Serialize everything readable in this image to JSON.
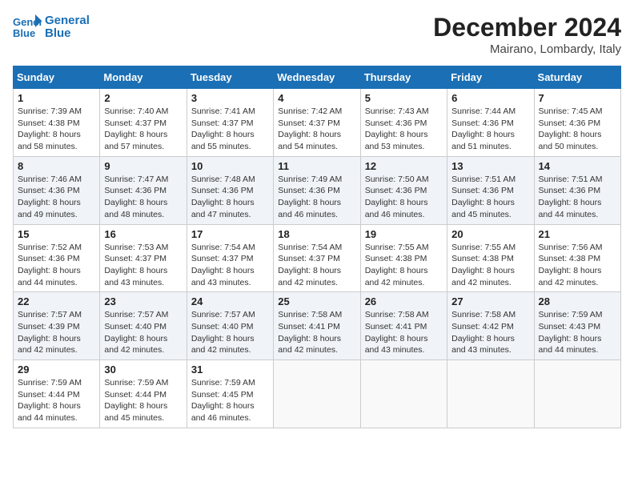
{
  "header": {
    "logo_line1": "General",
    "logo_line2": "Blue",
    "month_title": "December 2024",
    "location": "Mairano, Lombardy, Italy"
  },
  "weekdays": [
    "Sunday",
    "Monday",
    "Tuesday",
    "Wednesday",
    "Thursday",
    "Friday",
    "Saturday"
  ],
  "weeks": [
    [
      {
        "day": "1",
        "info": "Sunrise: 7:39 AM\nSunset: 4:38 PM\nDaylight: 8 hours\nand 58 minutes."
      },
      {
        "day": "2",
        "info": "Sunrise: 7:40 AM\nSunset: 4:37 PM\nDaylight: 8 hours\nand 57 minutes."
      },
      {
        "day": "3",
        "info": "Sunrise: 7:41 AM\nSunset: 4:37 PM\nDaylight: 8 hours\nand 55 minutes."
      },
      {
        "day": "4",
        "info": "Sunrise: 7:42 AM\nSunset: 4:37 PM\nDaylight: 8 hours\nand 54 minutes."
      },
      {
        "day": "5",
        "info": "Sunrise: 7:43 AM\nSunset: 4:36 PM\nDaylight: 8 hours\nand 53 minutes."
      },
      {
        "day": "6",
        "info": "Sunrise: 7:44 AM\nSunset: 4:36 PM\nDaylight: 8 hours\nand 51 minutes."
      },
      {
        "day": "7",
        "info": "Sunrise: 7:45 AM\nSunset: 4:36 PM\nDaylight: 8 hours\nand 50 minutes."
      }
    ],
    [
      {
        "day": "8",
        "info": "Sunrise: 7:46 AM\nSunset: 4:36 PM\nDaylight: 8 hours\nand 49 minutes."
      },
      {
        "day": "9",
        "info": "Sunrise: 7:47 AM\nSunset: 4:36 PM\nDaylight: 8 hours\nand 48 minutes."
      },
      {
        "day": "10",
        "info": "Sunrise: 7:48 AM\nSunset: 4:36 PM\nDaylight: 8 hours\nand 47 minutes."
      },
      {
        "day": "11",
        "info": "Sunrise: 7:49 AM\nSunset: 4:36 PM\nDaylight: 8 hours\nand 46 minutes."
      },
      {
        "day": "12",
        "info": "Sunrise: 7:50 AM\nSunset: 4:36 PM\nDaylight: 8 hours\nand 46 minutes."
      },
      {
        "day": "13",
        "info": "Sunrise: 7:51 AM\nSunset: 4:36 PM\nDaylight: 8 hours\nand 45 minutes."
      },
      {
        "day": "14",
        "info": "Sunrise: 7:51 AM\nSunset: 4:36 PM\nDaylight: 8 hours\nand 44 minutes."
      }
    ],
    [
      {
        "day": "15",
        "info": "Sunrise: 7:52 AM\nSunset: 4:36 PM\nDaylight: 8 hours\nand 44 minutes."
      },
      {
        "day": "16",
        "info": "Sunrise: 7:53 AM\nSunset: 4:37 PM\nDaylight: 8 hours\nand 43 minutes."
      },
      {
        "day": "17",
        "info": "Sunrise: 7:54 AM\nSunset: 4:37 PM\nDaylight: 8 hours\nand 43 minutes."
      },
      {
        "day": "18",
        "info": "Sunrise: 7:54 AM\nSunset: 4:37 PM\nDaylight: 8 hours\nand 42 minutes."
      },
      {
        "day": "19",
        "info": "Sunrise: 7:55 AM\nSunset: 4:38 PM\nDaylight: 8 hours\nand 42 minutes."
      },
      {
        "day": "20",
        "info": "Sunrise: 7:55 AM\nSunset: 4:38 PM\nDaylight: 8 hours\nand 42 minutes."
      },
      {
        "day": "21",
        "info": "Sunrise: 7:56 AM\nSunset: 4:38 PM\nDaylight: 8 hours\nand 42 minutes."
      }
    ],
    [
      {
        "day": "22",
        "info": "Sunrise: 7:57 AM\nSunset: 4:39 PM\nDaylight: 8 hours\nand 42 minutes."
      },
      {
        "day": "23",
        "info": "Sunrise: 7:57 AM\nSunset: 4:40 PM\nDaylight: 8 hours\nand 42 minutes."
      },
      {
        "day": "24",
        "info": "Sunrise: 7:57 AM\nSunset: 4:40 PM\nDaylight: 8 hours\nand 42 minutes."
      },
      {
        "day": "25",
        "info": "Sunrise: 7:58 AM\nSunset: 4:41 PM\nDaylight: 8 hours\nand 42 minutes."
      },
      {
        "day": "26",
        "info": "Sunrise: 7:58 AM\nSunset: 4:41 PM\nDaylight: 8 hours\nand 43 minutes."
      },
      {
        "day": "27",
        "info": "Sunrise: 7:58 AM\nSunset: 4:42 PM\nDaylight: 8 hours\nand 43 minutes."
      },
      {
        "day": "28",
        "info": "Sunrise: 7:59 AM\nSunset: 4:43 PM\nDaylight: 8 hours\nand 44 minutes."
      }
    ],
    [
      {
        "day": "29",
        "info": "Sunrise: 7:59 AM\nSunset: 4:44 PM\nDaylight: 8 hours\nand 44 minutes."
      },
      {
        "day": "30",
        "info": "Sunrise: 7:59 AM\nSunset: 4:44 PM\nDaylight: 8 hours\nand 45 minutes."
      },
      {
        "day": "31",
        "info": "Sunrise: 7:59 AM\nSunset: 4:45 PM\nDaylight: 8 hours\nand 46 minutes."
      },
      {
        "day": "",
        "info": ""
      },
      {
        "day": "",
        "info": ""
      },
      {
        "day": "",
        "info": ""
      },
      {
        "day": "",
        "info": ""
      }
    ]
  ]
}
